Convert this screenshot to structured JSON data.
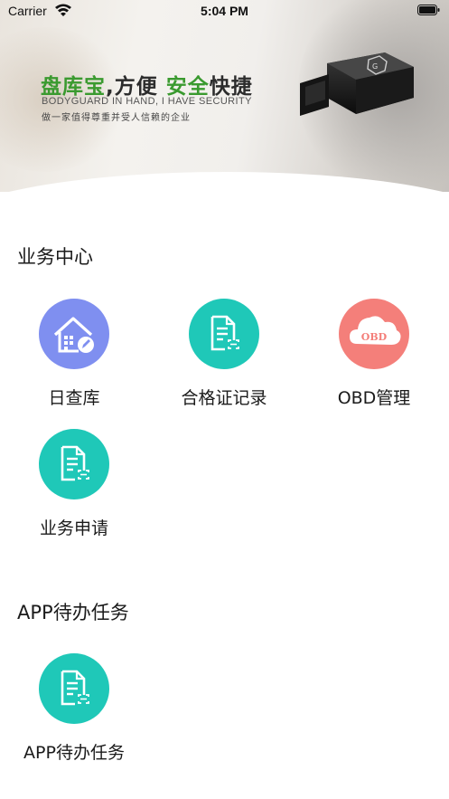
{
  "status_bar": {
    "carrier": "Carrier",
    "time": "5:04 PM"
  },
  "banner": {
    "slogan_part1": "盘库宝",
    "slogan_part2": ",方便 ",
    "slogan_part3": "安全",
    "slogan_part4": "快捷",
    "tagline_en": "BODYGUARD IN HAND, I HAVE SECURITY",
    "tagline_cn": "做一家值得尊重并受人信赖的企业",
    "device_badge": "G"
  },
  "business_center": {
    "title": "业务中心",
    "items": [
      {
        "label": "日查库",
        "icon": "warehouse-edit-icon",
        "color": "#7f8ff0"
      },
      {
        "label": "合格证记录",
        "icon": "document-scan-icon",
        "color": "#1fc8b8"
      },
      {
        "label": "OBD管理",
        "icon": "obd-cloud-icon",
        "color": "#f47f7a",
        "icon_text": "OBD"
      },
      {
        "label": "业务申请",
        "icon": "document-scan-icon",
        "color": "#1fc8b8"
      }
    ]
  },
  "app_tasks": {
    "title": "APP待办任务",
    "items": [
      {
        "label": "APP待办任务",
        "icon": "document-scan-icon",
        "color": "#1fc8b8"
      }
    ]
  }
}
